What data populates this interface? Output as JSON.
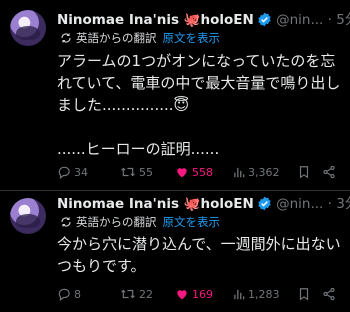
{
  "posts": [
    {
      "name": "Ninomae Ina'nis 🐙holoEN",
      "handle": "@nin...",
      "dot": "·",
      "time": "5分",
      "translated_from": "英語からの翻訳",
      "show_original": "原文を表示",
      "text": "アラームの1つがオンになっていたのを忘れていて、電車の中で最大音量で鳴り出しました...............😇\n\n......ヒーローの証明......",
      "replies": "34",
      "reposts": "55",
      "likes": "558",
      "views": "3,362",
      "liked": true
    },
    {
      "name": "Ninomae Ina'nis 🐙holoEN",
      "handle": "@nin...",
      "dot": "·",
      "time": "3分",
      "translated_from": "英語からの翻訳",
      "show_original": "原文を表示",
      "text": "今から穴に潜り込んで、一週間外に出ないつもりです。",
      "replies": "8",
      "reposts": "22",
      "likes": "169",
      "views": "1,283",
      "liked": true
    }
  ],
  "colors": {
    "background": "#000000",
    "text": "#e7e9ea",
    "muted": "#71767b",
    "link": "#1d9bf0",
    "like": "#f91880"
  },
  "icons": [
    "verified-icon",
    "translate-icon",
    "reply-icon",
    "repost-icon",
    "like-icon",
    "views-icon",
    "bookmark-icon",
    "share-icon"
  ]
}
